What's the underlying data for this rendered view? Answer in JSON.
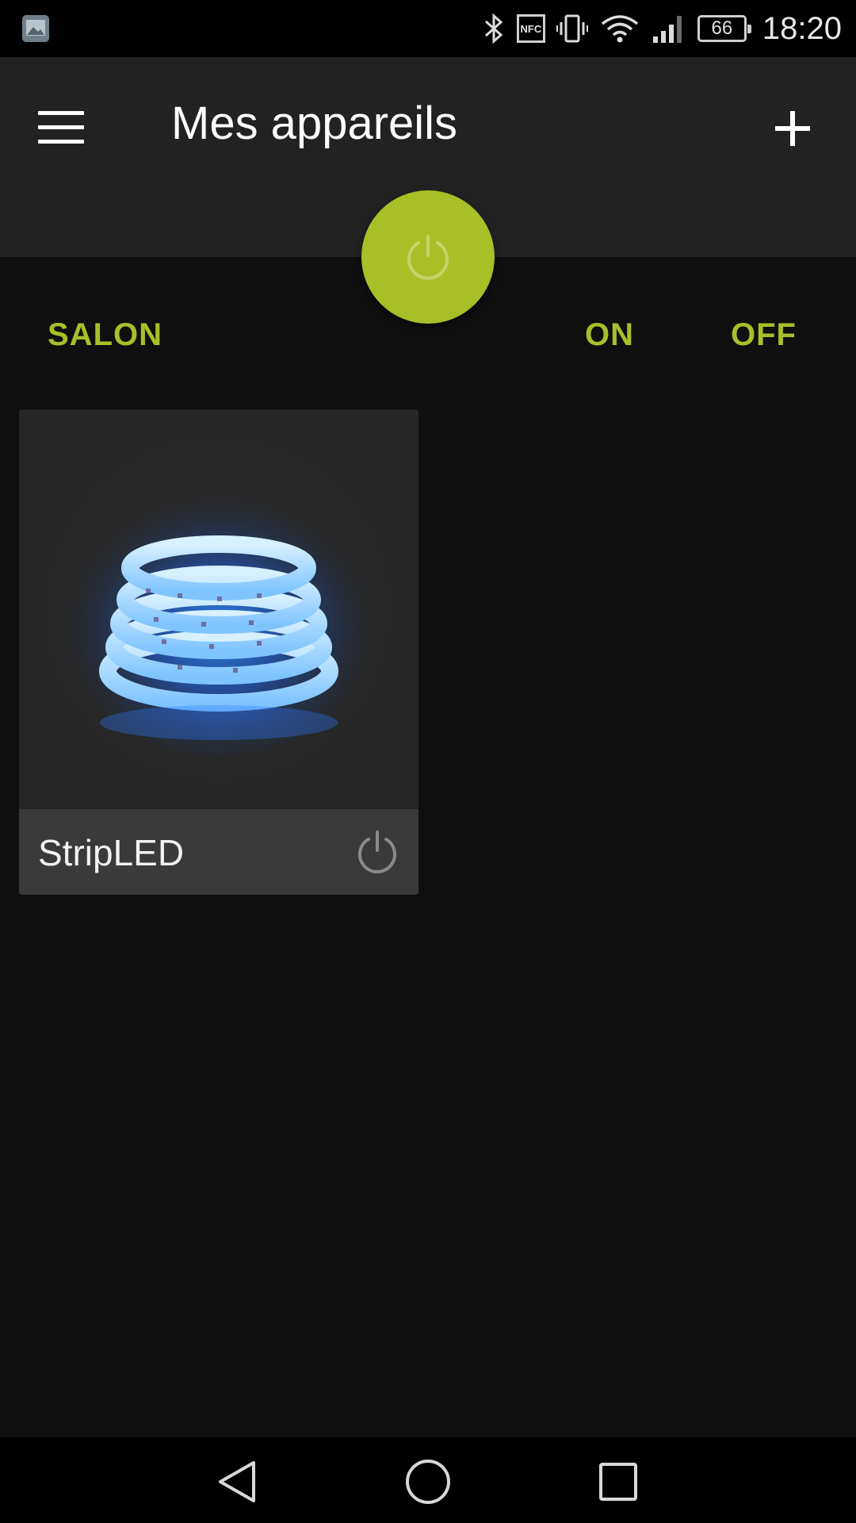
{
  "status_bar": {
    "icons": [
      "gallery-icon",
      "bluetooth-icon",
      "nfc-icon",
      "vibrate-icon",
      "wifi-icon",
      "signal-icon",
      "battery-icon"
    ],
    "nfc_label": "NFC",
    "battery_level": "66",
    "time": "18:20"
  },
  "app_bar": {
    "title": "Mes appareils",
    "menu_icon": "hamburger-menu-icon",
    "add_icon": "plus-icon"
  },
  "master_power": {
    "icon": "power-icon",
    "color": "#a9bf28"
  },
  "group": {
    "name": "SALON",
    "on_label": "ON",
    "off_label": "OFF",
    "accent_color": "#a9bf28"
  },
  "devices": [
    {
      "name": "StripLED",
      "image": "led-strip-image",
      "power_icon": "power-icon"
    }
  ],
  "nav_bar": {
    "icons": [
      "back-triangle-icon",
      "home-circle-icon",
      "recent-square-icon"
    ]
  }
}
